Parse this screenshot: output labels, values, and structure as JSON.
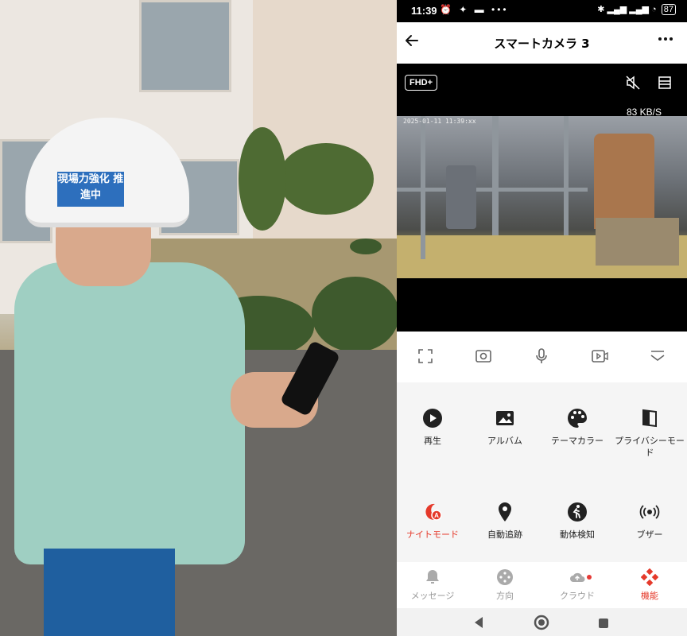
{
  "photo": {
    "helmet_sticker": "現場力強化 推進中"
  },
  "status_bar": {
    "time": "11:39",
    "notification_icons": "⏰ ✦ ▬ •••",
    "signal_icons": "✱ ▂▄▆ ▂▄▆ ◔",
    "battery": "87"
  },
  "app_bar": {
    "title": "スマートカメラ 3",
    "back_icon": "arrow-left",
    "more_icon": "more-horizontal"
  },
  "video": {
    "quality_label": "FHD+",
    "speed": "83 KB/S",
    "timestamp": "2025-01-11 11:39:xx"
  },
  "controls": [
    {
      "name": "fullscreen",
      "icon": "fullscreen-icon"
    },
    {
      "name": "screenshot",
      "icon": "screenshot-icon"
    },
    {
      "name": "talk",
      "icon": "microphone-icon"
    },
    {
      "name": "record",
      "icon": "video-record-icon"
    },
    {
      "name": "collapse",
      "icon": "collapse-icon"
    }
  ],
  "features": [
    {
      "label": "再生",
      "icon": "play-icon",
      "color": "#222222"
    },
    {
      "label": "アルバム",
      "icon": "album-icon",
      "color": "#222222"
    },
    {
      "label": "テーマカラー",
      "icon": "palette-icon",
      "color": "#222222"
    },
    {
      "label": "プライバシーモード",
      "icon": "privacy-icon",
      "color": "#222222"
    },
    {
      "label": "ナイトモード",
      "icon": "night-mode-icon",
      "color": "#e5392a"
    },
    {
      "label": "自動追跡",
      "icon": "location-pin-icon",
      "color": "#222222"
    },
    {
      "label": "動体検知",
      "icon": "motion-detect-icon",
      "color": "#222222"
    },
    {
      "label": "ブザー",
      "icon": "buzzer-icon",
      "color": "#222222"
    }
  ],
  "bottom_nav": [
    {
      "label": "メッセージ",
      "icon": "bell-icon",
      "active": false
    },
    {
      "label": "方向",
      "icon": "direction-icon",
      "active": false
    },
    {
      "label": "クラウド",
      "icon": "cloud-icon",
      "active": false,
      "badge": true
    },
    {
      "label": "機能",
      "icon": "features-icon",
      "active": true
    }
  ],
  "colors": {
    "accent": "#e5392a",
    "video_bg": "#000000",
    "grid_bg": "#f5f5f5"
  }
}
